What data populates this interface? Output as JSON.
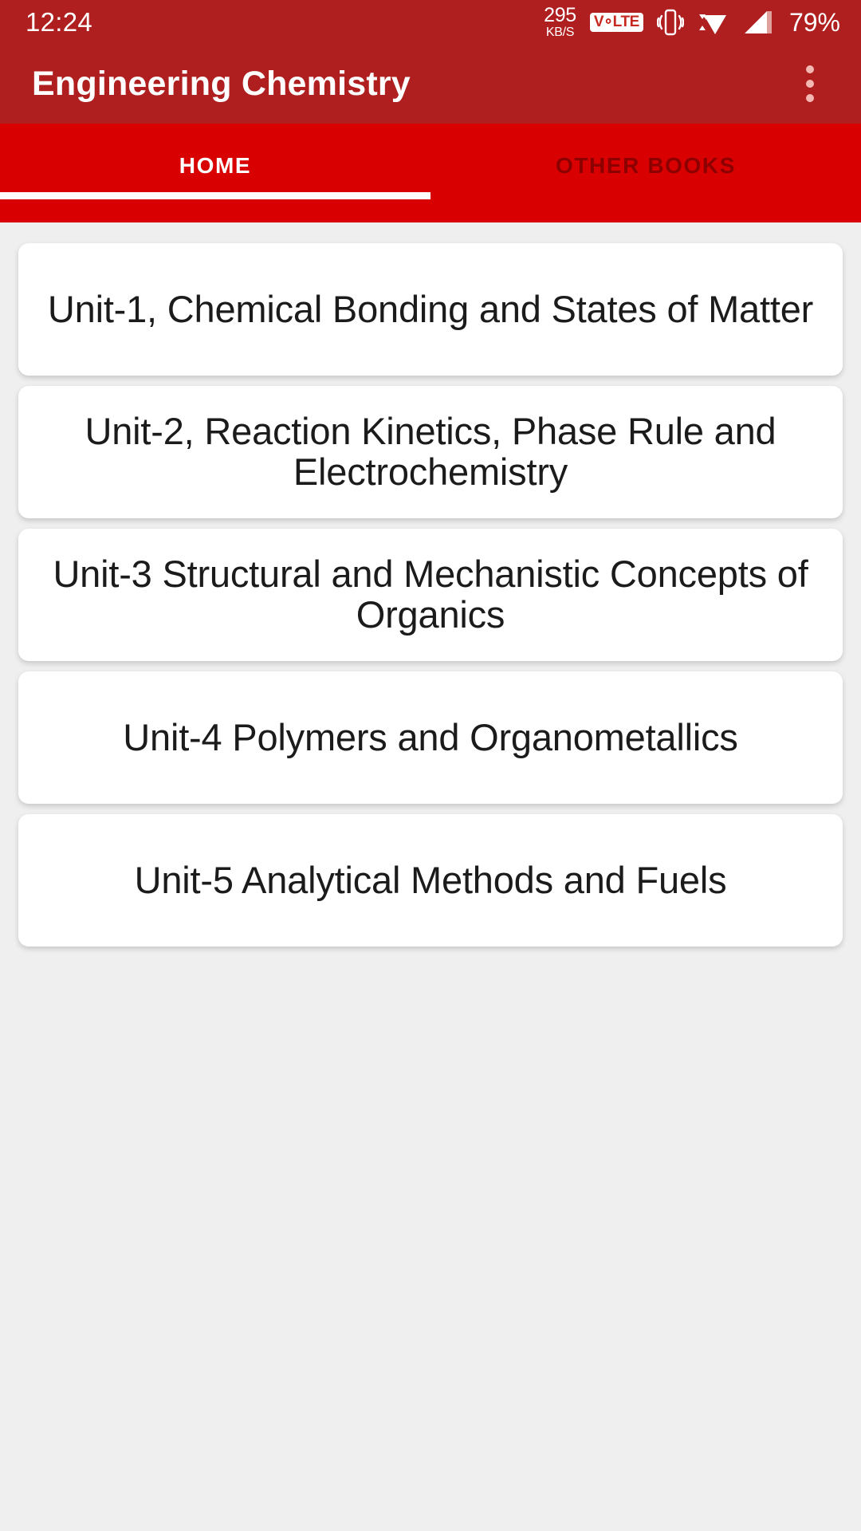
{
  "status_bar": {
    "time": "12:24",
    "network_speed_value": "295",
    "network_speed_unit": "KB/S",
    "volte_label": "V∘LTE",
    "battery_percent": "79%",
    "icons": [
      "vibrate-icon",
      "wifi-icon",
      "signal-icon"
    ],
    "background_color": "#b01f1f",
    "foreground_color": "#ffffff"
  },
  "app_bar": {
    "title": "Engineering Chemistry",
    "overflow_menu_label": "More options",
    "background_color": "#b01f1f"
  },
  "tabs": {
    "background_color": "#d80000",
    "indicator_color": "#ffffff",
    "items": [
      {
        "label": "HOME",
        "active": true
      },
      {
        "label": "OTHER BOOKS",
        "active": false
      }
    ]
  },
  "content": {
    "background_color": "#efefef",
    "card_color": "#ffffff",
    "cards": [
      {
        "title": "Unit-1, Chemical Bonding and States of Matter"
      },
      {
        "title": "Unit-2, Reaction Kinetics, Phase Rule and Electrochemistry"
      },
      {
        "title": "Unit-3 Structural and Mechanistic Concepts of Organics"
      },
      {
        "title": "Unit-4 Polymers and Organometallics"
      },
      {
        "title": "Unit-5 Analytical Methods and Fuels"
      }
    ]
  }
}
